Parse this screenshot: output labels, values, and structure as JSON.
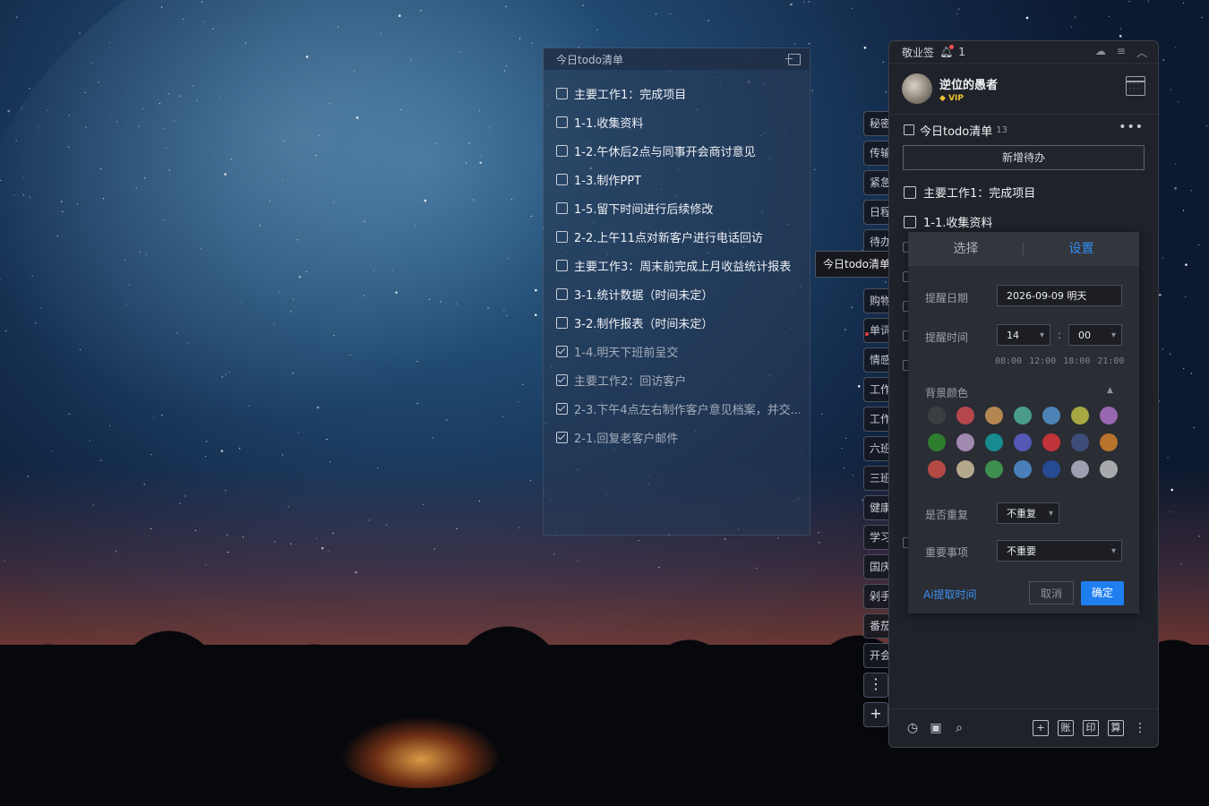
{
  "float_panel": {
    "title": "今日todo清单",
    "items": [
      {
        "text": "主要工作1：完成项目",
        "done": false
      },
      {
        "text": "1-1.收集资料",
        "done": false
      },
      {
        "text": "1-2.午休后2点与同事开会商讨意见",
        "done": false
      },
      {
        "text": "1-3.制作PPT",
        "done": false
      },
      {
        "text": "1-5.留下时间进行后续修改",
        "done": false
      },
      {
        "text": "2-2.上午11点对新客户进行电话回访",
        "done": false
      },
      {
        "text": "主要工作3：周末前完成上月收益统计报表",
        "done": false
      },
      {
        "text": "3-1.统计数据（时间未定）",
        "done": false
      },
      {
        "text": "3-2.制作报表（时间未定）",
        "done": false
      },
      {
        "text": "1-4.明天下班前呈交",
        "done": true
      },
      {
        "text": "主要工作2：回访客户",
        "done": true
      },
      {
        "text": "2-3.下午4点左右制作客户意见档案，并交...",
        "done": true
      },
      {
        "text": "2-1.回复老客户邮件",
        "done": true
      }
    ]
  },
  "side_tabs": [
    "秘密",
    "传输",
    "紧急",
    "日程",
    "待办",
    "今日todo清单",
    "购物",
    "单词",
    "情感",
    "工作",
    "工作",
    "六班",
    "三班",
    "健康",
    "学习",
    "国庆",
    "剁手",
    "番茄",
    "开会"
  ],
  "side_tab_popup": "今日todo清单",
  "side_buttons": {
    "more": "⋮",
    "add": "+"
  },
  "app": {
    "title": "敬业签",
    "notif_count": "1",
    "username": "逆位的愚者",
    "vip": "VIP",
    "list_title": "今日todo清单",
    "list_count": "13",
    "more_menu": "•••",
    "add_button": "新增待办",
    "items": [
      "主要工作1：完成项目",
      "1-1.收集资料"
    ],
    "bottom_icons": [
      "clock-icon",
      "archive-icon",
      "search-icon"
    ],
    "bottom_tools": [
      "+",
      "账",
      "印",
      "算"
    ]
  },
  "reminder": {
    "tabs": [
      "选择",
      "设置"
    ],
    "active_tab": 1,
    "date_label": "提醒日期",
    "date_value": "2026-09-09 明天",
    "time_label": "提醒时间",
    "hour": "14",
    "minute": "00",
    "quick_times": "08:00 12:00 18:00 21:00",
    "bg_color_label": "背景颜色",
    "colors": [
      "#3a3d42",
      "#b5474d",
      "#b48651",
      "#4a9c8a",
      "#4d82b6",
      "#a8a843",
      "#9967b1",
      "#2f7d2e",
      "#a18ab0",
      "#178b8f",
      "#5558b5",
      "#c03338",
      "#3e4e7a",
      "#b8742b",
      "#b54a45",
      "#b5a98d",
      "#3f8f4f",
      "#4a7fbc",
      "#264b92",
      "#9b9fae",
      "#a7a9ad"
    ],
    "repeat_label": "是否重复",
    "repeat_value": "不重复",
    "important_label": "重要事项",
    "important_value": "不重要",
    "ai_link": "Ai提取时间",
    "cancel": "取消",
    "ok": "确定"
  }
}
